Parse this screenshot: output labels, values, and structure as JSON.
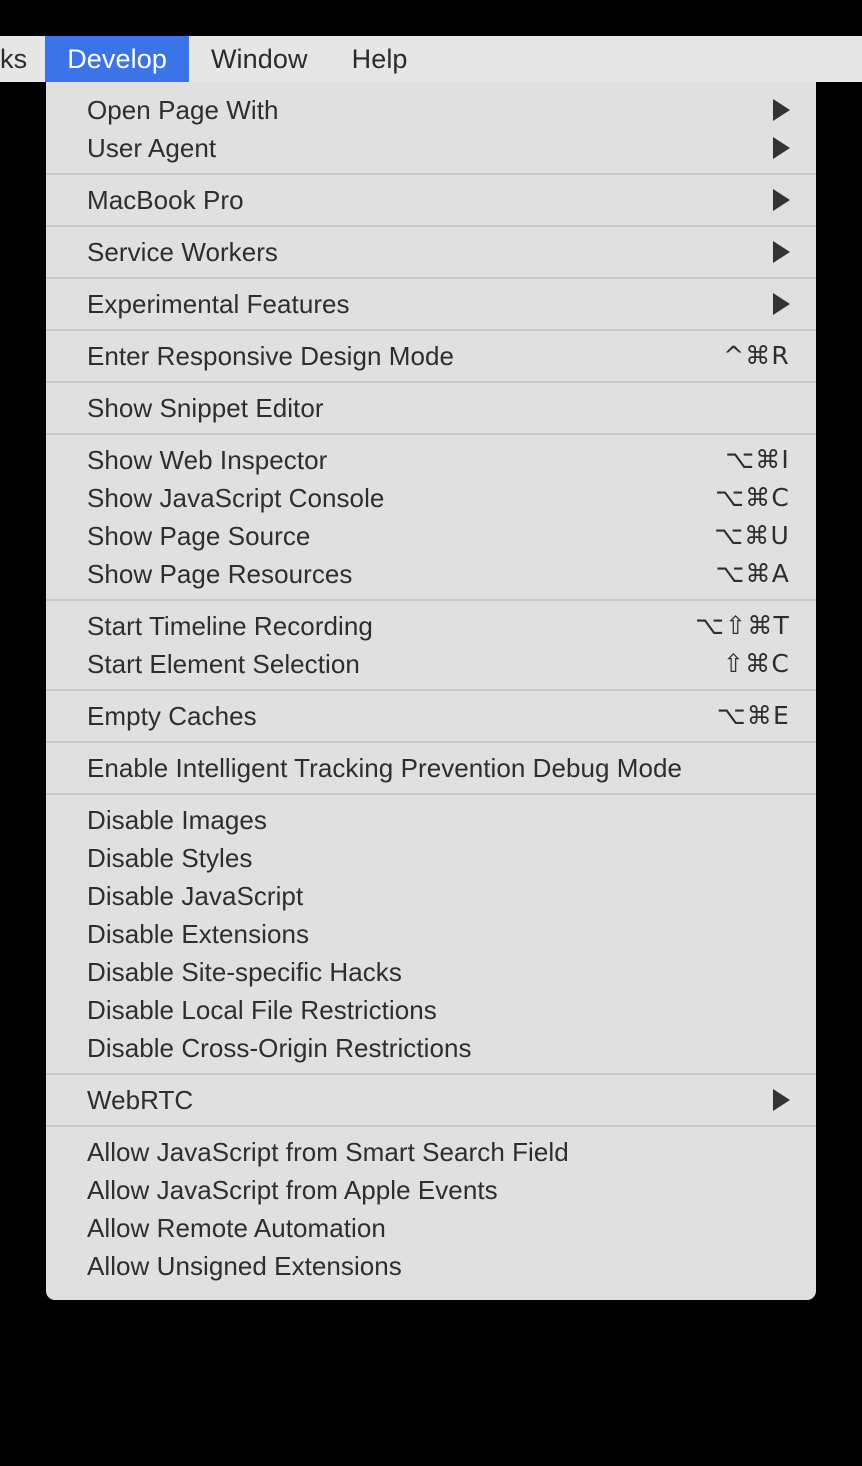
{
  "menubar": {
    "items": [
      {
        "label": "ks",
        "active": false,
        "clipped": true
      },
      {
        "label": "Develop",
        "active": true,
        "clipped": false
      },
      {
        "label": "Window",
        "active": false,
        "clipped": false
      },
      {
        "label": "Help",
        "active": false,
        "clipped": false
      }
    ]
  },
  "colors": {
    "menubar_background": "#e6e6e6",
    "menu_background": "#e0e0e0",
    "highlight_blue": "#3a74e8",
    "separator": "#c9c9c9",
    "text": "#2e2e2e",
    "highlight_text": "#ffffff",
    "desktop": "#000000"
  },
  "menu": {
    "title": "Develop",
    "groups": [
      {
        "items": [
          {
            "label": "Open Page With",
            "shortcut": "",
            "submenu": true
          },
          {
            "label": "User Agent",
            "shortcut": "",
            "submenu": true
          }
        ]
      },
      {
        "items": [
          {
            "label": "MacBook Pro",
            "shortcut": "",
            "submenu": true
          }
        ]
      },
      {
        "items": [
          {
            "label": "Service Workers",
            "shortcut": "",
            "submenu": true
          }
        ]
      },
      {
        "items": [
          {
            "label": "Experimental Features",
            "shortcut": "",
            "submenu": true
          }
        ]
      },
      {
        "items": [
          {
            "label": "Enter Responsive Design Mode",
            "shortcut": "^⌘R",
            "submenu": false
          }
        ]
      },
      {
        "items": [
          {
            "label": "Show Snippet Editor",
            "shortcut": "",
            "submenu": false
          }
        ]
      },
      {
        "items": [
          {
            "label": "Show Web Inspector",
            "shortcut": "⌥⌘I",
            "submenu": false
          },
          {
            "label": "Show JavaScript Console",
            "shortcut": "⌥⌘C",
            "submenu": false
          },
          {
            "label": "Show Page Source",
            "shortcut": "⌥⌘U",
            "submenu": false
          },
          {
            "label": "Show Page Resources",
            "shortcut": "⌥⌘A",
            "submenu": false
          }
        ]
      },
      {
        "items": [
          {
            "label": "Start Timeline Recording",
            "shortcut": "⌥⇧⌘T",
            "submenu": false
          },
          {
            "label": "Start Element Selection",
            "shortcut": "⇧⌘C",
            "submenu": false
          }
        ]
      },
      {
        "items": [
          {
            "label": "Empty Caches",
            "shortcut": "⌥⌘E",
            "submenu": false
          }
        ]
      },
      {
        "items": [
          {
            "label": "Enable Intelligent Tracking Prevention Debug Mode",
            "shortcut": "",
            "submenu": false
          }
        ]
      },
      {
        "items": [
          {
            "label": "Disable Images",
            "shortcut": "",
            "submenu": false
          },
          {
            "label": "Disable Styles",
            "shortcut": "",
            "submenu": false
          },
          {
            "label": "Disable JavaScript",
            "shortcut": "",
            "submenu": false
          },
          {
            "label": "Disable Extensions",
            "shortcut": "",
            "submenu": false
          },
          {
            "label": "Disable Site-specific Hacks",
            "shortcut": "",
            "submenu": false
          },
          {
            "label": "Disable Local File Restrictions",
            "shortcut": "",
            "submenu": false
          },
          {
            "label": "Disable Cross-Origin Restrictions",
            "shortcut": "",
            "submenu": false
          }
        ]
      },
      {
        "items": [
          {
            "label": "WebRTC",
            "shortcut": "",
            "submenu": true
          }
        ]
      },
      {
        "items": [
          {
            "label": "Allow JavaScript from Smart Search Field",
            "shortcut": "",
            "submenu": false
          },
          {
            "label": "Allow JavaScript from Apple Events",
            "shortcut": "",
            "submenu": false
          },
          {
            "label": "Allow Remote Automation",
            "shortcut": "",
            "submenu": false
          },
          {
            "label": "Allow Unsigned Extensions",
            "shortcut": "",
            "submenu": false
          }
        ]
      }
    ]
  }
}
